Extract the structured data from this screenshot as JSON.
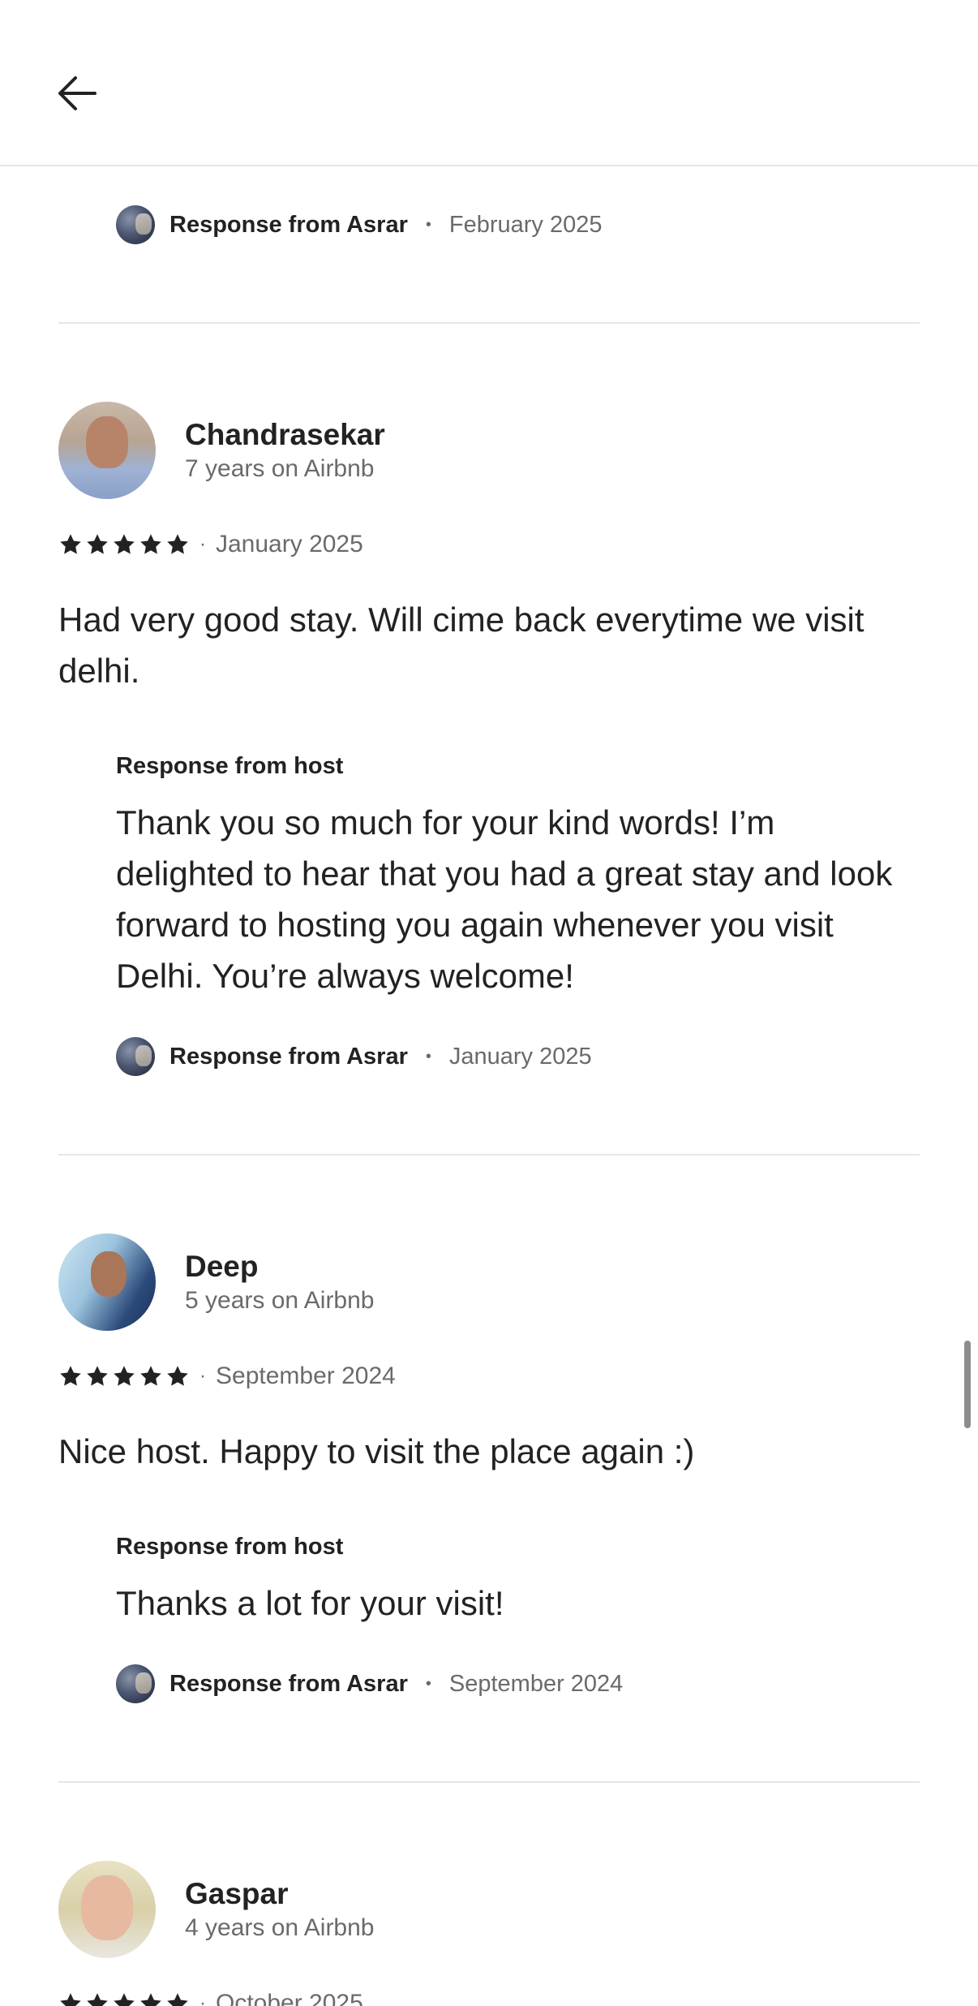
{
  "header": {
    "back_icon": "arrow-left-icon"
  },
  "top_response": {
    "name": "Response from Asrar",
    "date": "February 2025"
  },
  "reviews": [
    {
      "name": "Chandrasekar",
      "tenure": "7 years on Airbnb",
      "rating": 5,
      "date": "January 2025",
      "text": "Had very good stay. Will cime back everytime we visit delhi.",
      "host_label": "Response from host",
      "host_text": "Thank you so much for your kind words! I’m delighted to hear that you had a great stay and look forward to hosting you again whenever you visit Delhi. You’re always welcome!",
      "response_name": "Response from Asrar",
      "response_date": "January 2025"
    },
    {
      "name": "Deep",
      "tenure": "5 years on Airbnb",
      "rating": 5,
      "date": "September 2024",
      "text": "Nice host. Happy to visit the place again :)",
      "host_label": "Response from host",
      "host_text": "Thanks a lot for your visit!",
      "response_name": "Response from Asrar",
      "response_date": "September 2024"
    },
    {
      "name": "Gaspar",
      "tenure": "4 years on Airbnb",
      "rating": 5,
      "date": "October 2025"
    }
  ],
  "separator": "·",
  "bullet": "•"
}
